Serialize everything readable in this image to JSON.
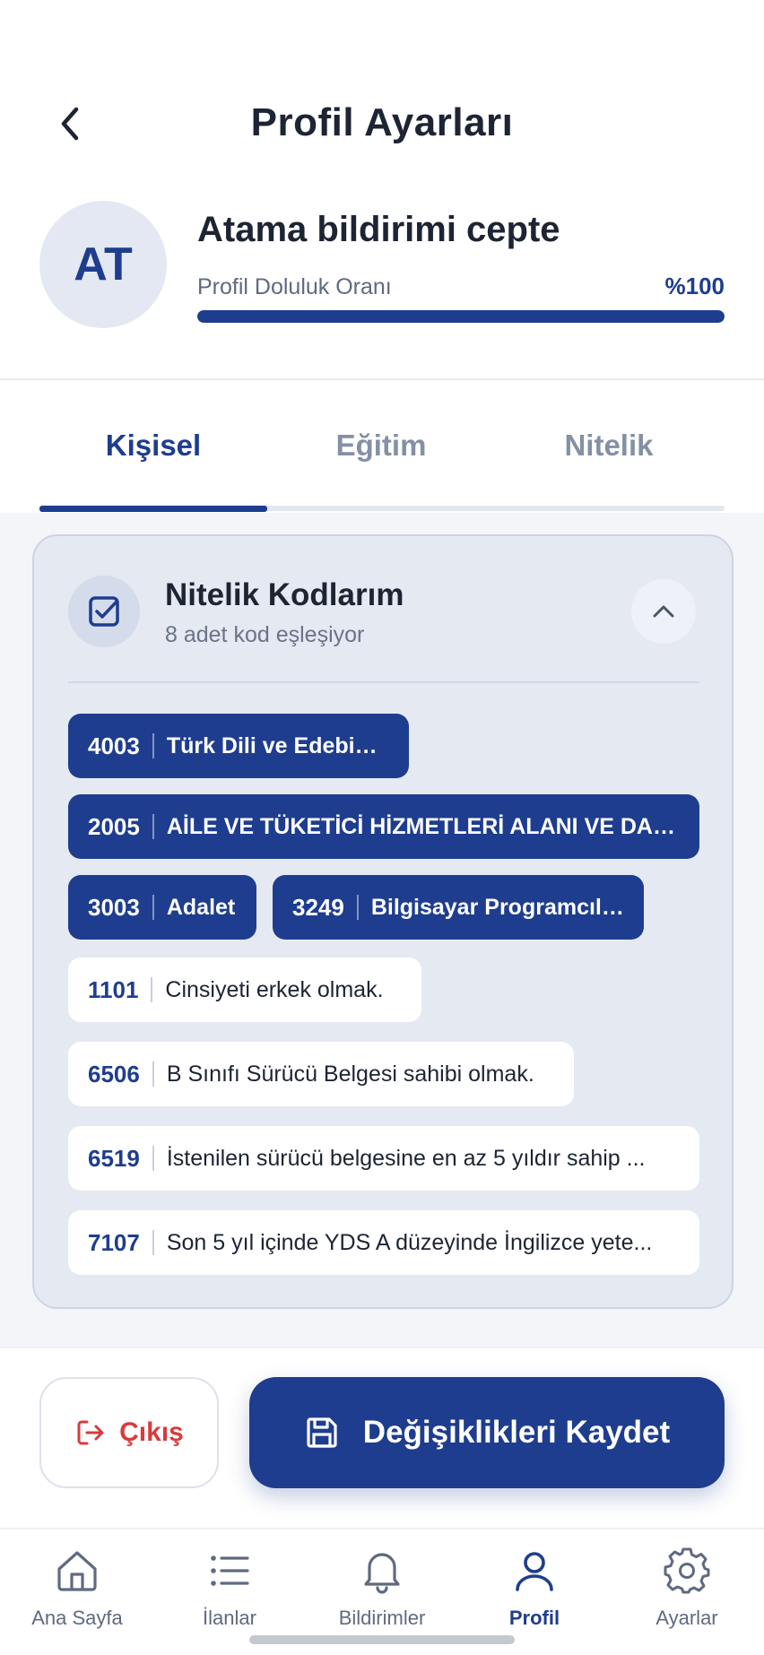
{
  "header": {
    "title": "Profil Ayarları"
  },
  "profile": {
    "initials": "AT",
    "name": "Atama bildirimi cepte",
    "fill_label": "Profil Doluluk Oranı",
    "fill_value": "%100",
    "fill_fraction": 1.0
  },
  "tabs": [
    {
      "label": "Kişisel",
      "active": true
    },
    {
      "label": "Eğitim",
      "active": false
    },
    {
      "label": "Nitelik",
      "active": false
    }
  ],
  "card": {
    "title": "Nitelik Kodlarım",
    "subtitle": "8 adet kod eşleşiyor",
    "codes": [
      {
        "code": "4003",
        "label": "Türk Dili ve Edebiyatı",
        "style": "filled"
      },
      {
        "code": "2005",
        "label": "AİLE VE TÜKETİCİ HİZMETLERİ ALANI VE DAL...",
        "style": "filled"
      },
      {
        "code": "3003",
        "label": "Adalet",
        "style": "filled"
      },
      {
        "code": "3249",
        "label": "Bilgisayar Programcılığı",
        "style": "filled"
      },
      {
        "code": "1101",
        "label": "Cinsiyeti erkek olmak.",
        "style": "outline"
      },
      {
        "code": "6506",
        "label": "B Sınıfı Sürücü Belgesi sahibi olmak.",
        "style": "outline"
      },
      {
        "code": "6519",
        "label": "İstenilen sürücü belgesine en az 5 yıldır sahip ...",
        "style": "outline"
      },
      {
        "code": "7107",
        "label": "Son 5 yıl içinde YDS A düzeyinde İngilizce yete...",
        "style": "outline"
      }
    ]
  },
  "actions": {
    "logout_label": "Çıkış",
    "save_label": "Değişiklikleri Kaydet"
  },
  "nav": [
    {
      "label": "Ana Sayfa",
      "icon": "home-icon",
      "active": false
    },
    {
      "label": "İlanlar",
      "icon": "list-icon",
      "active": false
    },
    {
      "label": "Bildirimler",
      "icon": "bell-icon",
      "active": false
    },
    {
      "label": "Profil",
      "icon": "user-icon",
      "active": true
    },
    {
      "label": "Ayarlar",
      "icon": "gear-icon",
      "active": false
    }
  ],
  "colors": {
    "primary": "#1e3d8f",
    "danger": "#d93b3b",
    "card_bg": "#e5e9f2"
  }
}
